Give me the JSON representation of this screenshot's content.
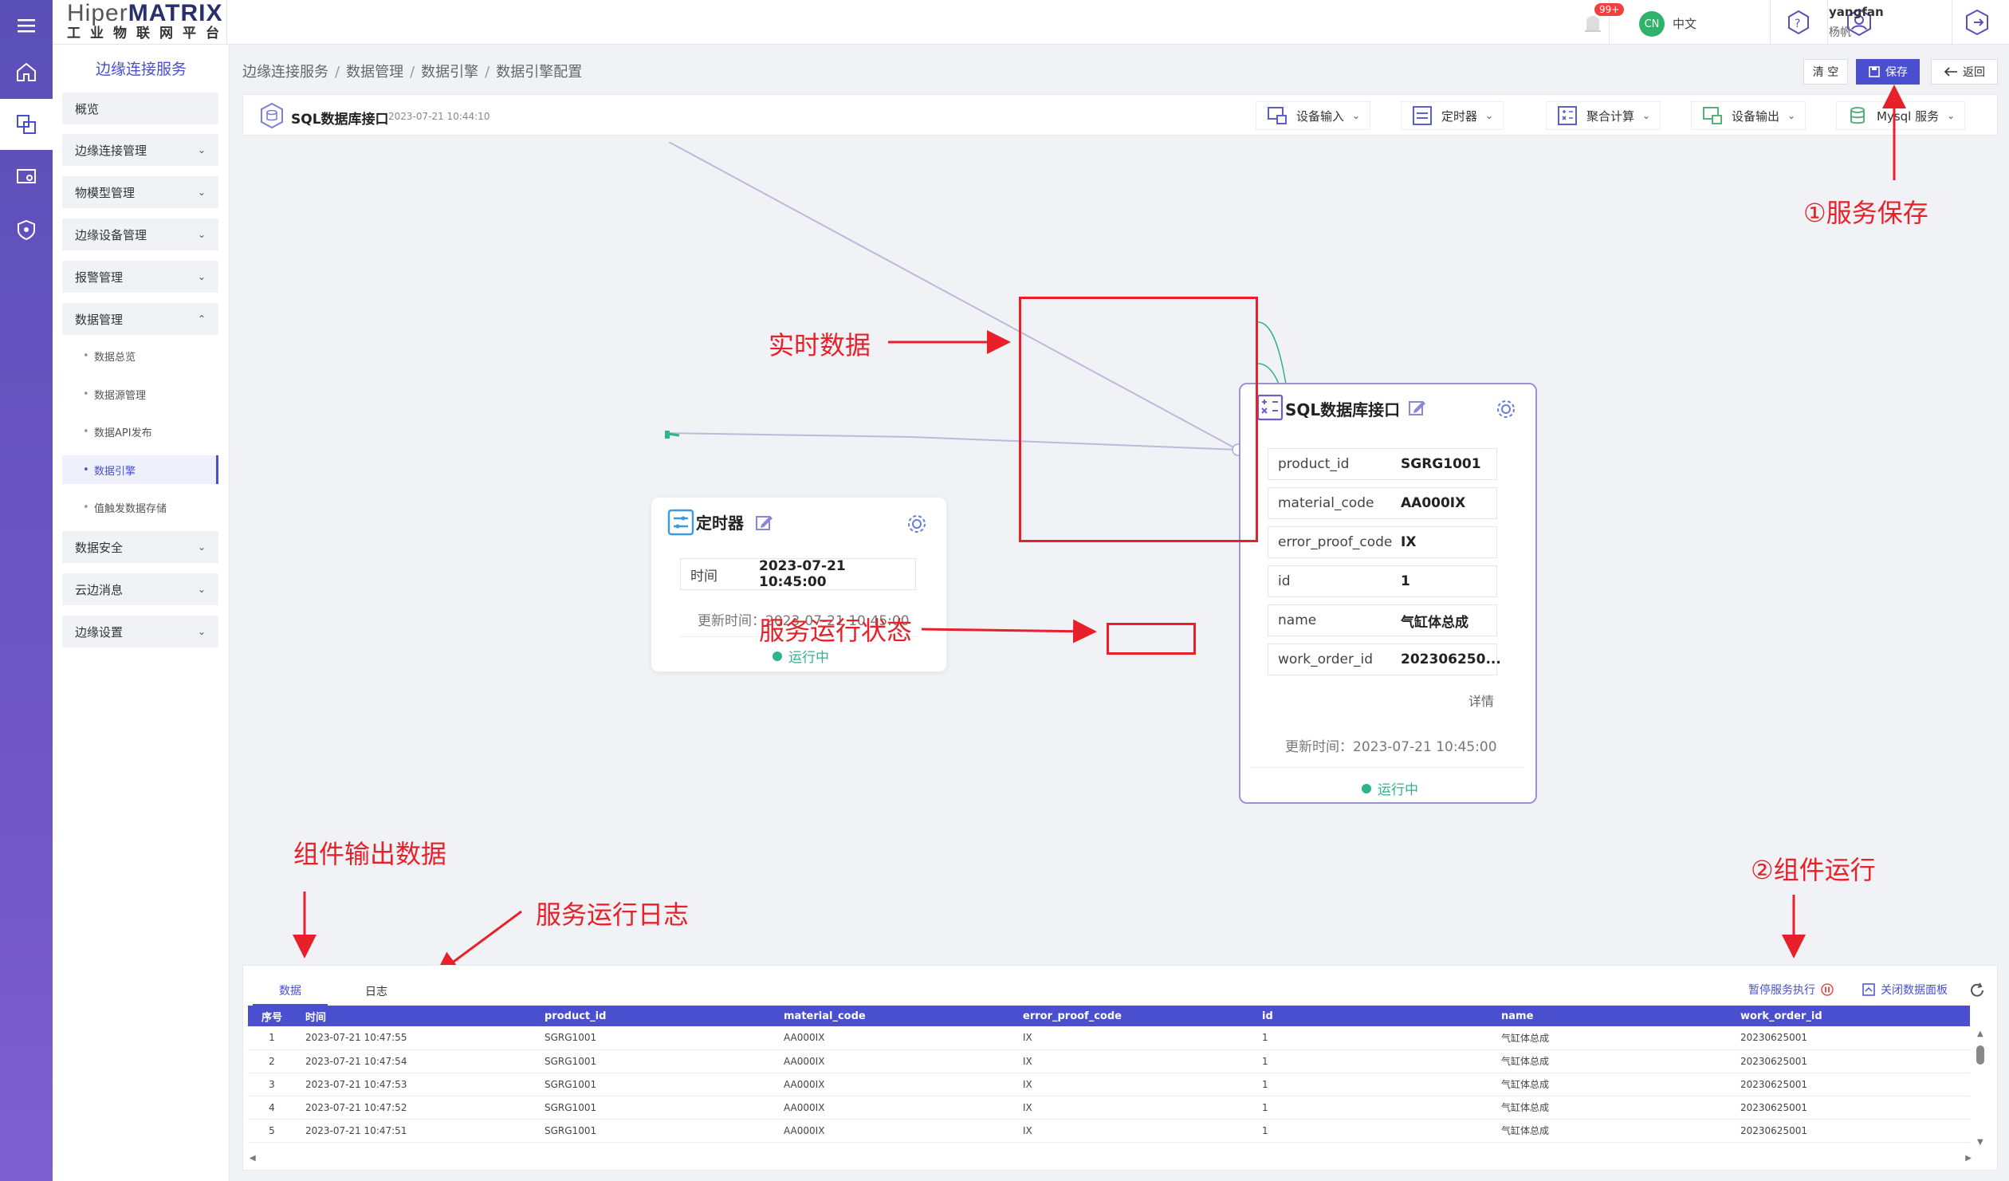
{
  "header": {
    "logo_main_a": "Hiper",
    "logo_main_b": "MATRIX",
    "logo_sub": "工业物联网平台",
    "notification_badge": "99+",
    "lang_code": "CN",
    "lang_label": "中文",
    "user_name": "yangfan",
    "user_display": "杨帆"
  },
  "sidebar": {
    "title": "边缘连接服务",
    "items": [
      {
        "label": "概览"
      },
      {
        "label": "边缘连接管理"
      },
      {
        "label": "物模型管理"
      },
      {
        "label": "边缘设备管理"
      },
      {
        "label": "报警管理"
      },
      {
        "label": "数据管理"
      },
      {
        "label": "数据安全"
      },
      {
        "label": "云边消息"
      },
      {
        "label": "边缘设置"
      }
    ],
    "data_sub": [
      {
        "label": "数据总览"
      },
      {
        "label": "数据源管理"
      },
      {
        "label": "数据API发布"
      },
      {
        "label": "数据引擎"
      },
      {
        "label": "值触发数据存储"
      }
    ]
  },
  "breadcrumb": [
    "边缘连接服务",
    "数据管理",
    "数据引擎",
    "数据引擎配置"
  ],
  "actions": {
    "clear": "清 空",
    "save": "保存",
    "back": "返回"
  },
  "toolbar": {
    "title": "SQL数据库接口",
    "timestamp": "2023-07-21 10:44:10",
    "menus": [
      "设备输入",
      "定时器",
      "聚合计算",
      "设备输出",
      "Mysql 服务"
    ]
  },
  "timer_node": {
    "title": "定时器",
    "field_key": "时间",
    "field_value": "2023-07-21 10:45:00",
    "updated": "更新时间：2023-07-21 10:45:00",
    "status": "运行中"
  },
  "sql_node": {
    "title": "SQL数据库接口",
    "fields": [
      {
        "key": "product_id",
        "value": "SGRG1001"
      },
      {
        "key": "material_code",
        "value": "AA000IX"
      },
      {
        "key": "error_proof_code",
        "value": "IX"
      },
      {
        "key": "id",
        "value": "1"
      },
      {
        "key": "name",
        "value": "气缸体总成"
      },
      {
        "key": "work_order_id",
        "value": "202306250..."
      }
    ],
    "detail": "详情",
    "updated": "更新时间：2023-07-21 10:45:00",
    "status": "运行中"
  },
  "annotations": {
    "save": "①服务保存",
    "realtime": "实时数据",
    "run_status": "服务运行状态",
    "output": "组件输出数据",
    "log": "服务运行日志",
    "run": "②组件运行"
  },
  "panel": {
    "tabs": [
      "数据",
      "日志"
    ],
    "pause_btn": "暂停服务执行",
    "close_btn": "关闭数据面板",
    "columns": [
      "序号",
      "时间",
      "product_id",
      "material_code",
      "error_proof_code",
      "id",
      "name",
      "work_order_id"
    ],
    "rows": [
      [
        "1",
        "2023-07-21 10:47:55",
        "SGRG1001",
        "AA000IX",
        "IX",
        "1",
        "气缸体总成",
        "20230625001"
      ],
      [
        "2",
        "2023-07-21 10:47:54",
        "SGRG1001",
        "AA000IX",
        "IX",
        "1",
        "气缸体总成",
        "20230625001"
      ],
      [
        "3",
        "2023-07-21 10:47:53",
        "SGRG1001",
        "AA000IX",
        "IX",
        "1",
        "气缸体总成",
        "20230625001"
      ],
      [
        "4",
        "2023-07-21 10:47:52",
        "SGRG1001",
        "AA000IX",
        "IX",
        "1",
        "气缸体总成",
        "20230625001"
      ],
      [
        "5",
        "2023-07-21 10:47:51",
        "SGRG1001",
        "AA000IX",
        "IX",
        "1",
        "气缸体总成",
        "20230625001"
      ]
    ]
  },
  "colors": {
    "accent": "#4a4fcf",
    "running": "#2fb38a",
    "annotation": "#e8202a"
  }
}
